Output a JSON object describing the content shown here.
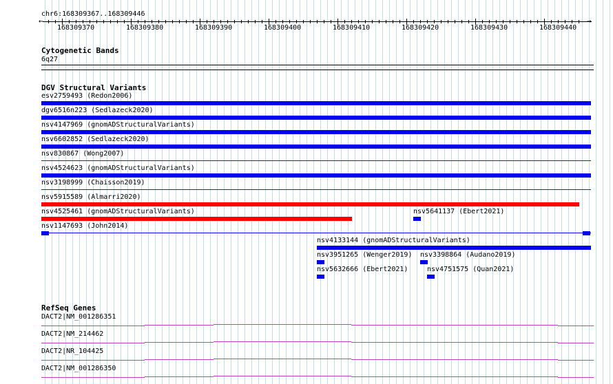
{
  "ruler": {
    "region": "chr6:168309367..168309446",
    "start": 168309367,
    "end": 168309446,
    "ticks": [
      "168309370",
      "168309380",
      "168309390",
      "168309400",
      "168309410",
      "168309420",
      "168309430",
      "168309440"
    ],
    "arrow_left": "←",
    "arrow_right": "→"
  },
  "cytoband": {
    "title": "Cytogenetic Bands",
    "band": "6q27"
  },
  "dgv": {
    "title": "DGV Structural Variants",
    "colors": {
      "gain": "#0000ee",
      "loss": "#ff0000",
      "complex": "#a00000",
      "thin": "#0000ee"
    },
    "features": [
      {
        "label": "esv2759493 (Redon2006)",
        "type": "gain",
        "style": "thick",
        "from": 168309367,
        "to": 168309446,
        "label_at": 168309367
      },
      {
        "label": "dgv6516n223 (Sedlazeck2020)",
        "type": "gain",
        "style": "thick",
        "from": 168309367,
        "to": 168309446,
        "label_at": 168309367
      },
      {
        "label": "nsv4147969 (gnomADStructuralVariants)",
        "type": "gain",
        "style": "thick",
        "from": 168309367,
        "to": 168309446,
        "label_at": 168309367
      },
      {
        "label": "nsv6602852 (Sedlazeck2020)",
        "type": "gain",
        "style": "thick",
        "from": 168309367,
        "to": 168309446,
        "label_at": 168309367
      },
      {
        "label": "nsv830867 (Wong2007)",
        "type": "complex",
        "style": "thin",
        "from": 168309367,
        "to": 168309446,
        "label_at": 168309367
      },
      {
        "label": "nsv4524623 (gnomADStructuralVariants)",
        "type": "gain",
        "style": "thick",
        "from": 168309367,
        "to": 168309446,
        "label_at": 168309367
      },
      {
        "label": "nsv3198999 (Chaisson2019)",
        "type": "complex",
        "style": "thin",
        "from": 168309367,
        "to": 168309446,
        "label_at": 168309367
      },
      {
        "label": "nsv5915589 (Almarri2020)",
        "type": "loss",
        "style": "thick",
        "from": 168309367,
        "to": 168309445,
        "label_at": 168309367
      },
      {
        "label": "nsv4525461 (gnomADStructuralVariants)",
        "type": "loss",
        "style": "thick",
        "from": 168309367,
        "to": 168309412,
        "label_at": 168309367
      },
      {
        "label": "nsv5641137 (Ebert2021)",
        "type": "gain",
        "style": "thick",
        "from": 168309421,
        "to": 168309422,
        "label_at": 168309421
      },
      {
        "label": "nsv1147693 (John2014)",
        "type": "gain",
        "style": "split",
        "from": 168309367,
        "to": 168309446,
        "label_at": 168309367
      },
      {
        "label": "nsv4133144 (gnomADStructuralVariants)",
        "type": "gain",
        "style": "thick",
        "from": 168309407,
        "to": 168309446,
        "label_at": 168309407
      },
      {
        "label": "nsv3951265 (Wenger2019)",
        "type": "gain",
        "style": "thick",
        "from": 168309407,
        "to": 168309408,
        "label_at": 168309407
      },
      {
        "label": "nsv3398864 (Audano2019)",
        "type": "gain",
        "style": "thick",
        "from": 168309422,
        "to": 168309423,
        "label_at": 168309422
      },
      {
        "label": "nsv5632666 (Ebert2021)",
        "type": "gain",
        "style": "thick",
        "from": 168309407,
        "to": 168309408,
        "label_at": 168309407
      },
      {
        "label": "nsv4751575 (Quan2021)",
        "type": "gain",
        "style": "thick",
        "from": 168309423,
        "to": 168309424,
        "label_at": 168309423
      }
    ]
  },
  "refseq": {
    "title": "RefSeq Genes",
    "color": "#c040c0",
    "genes": [
      {
        "label": "DACT2|NM_001286351"
      },
      {
        "label": "DACT2|NM_214462"
      },
      {
        "label": "DACT2|NR_104425"
      },
      {
        "label": "DACT2|NM_001286350"
      }
    ]
  }
}
